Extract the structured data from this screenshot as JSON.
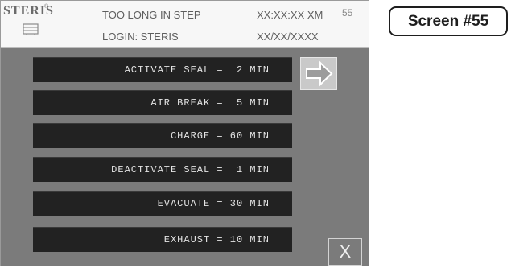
{
  "header": {
    "logo": "STERIS",
    "logo_mark": "®",
    "status": "TOO LONG IN STEP",
    "login": "LOGIN: STERIS",
    "time": "XX:XX:XX XM",
    "date": "XX/XX/XXXX",
    "screen_number": "55"
  },
  "parameters": [
    {
      "text": "ACTIVATE SEAL =  2 MIN"
    },
    {
      "text": "AIR BREAK =  5 MIN"
    },
    {
      "text": "CHARGE = 60 MIN"
    },
    {
      "text": "DEACTIVATE SEAL =  1 MIN"
    },
    {
      "text": "EVACUATE = 30 MIN"
    },
    {
      "text": "EXHAUST = 10 MIN"
    }
  ],
  "buttons": {
    "next_icon": "right-arrow-icon",
    "close_label": "X"
  },
  "callout": {
    "label": "Screen #55"
  },
  "colors": {
    "header_bg": "#f7f7f7",
    "body_bg": "#7b7b7b",
    "row_bg": "#222222",
    "row_text": "#e4e4e4"
  }
}
